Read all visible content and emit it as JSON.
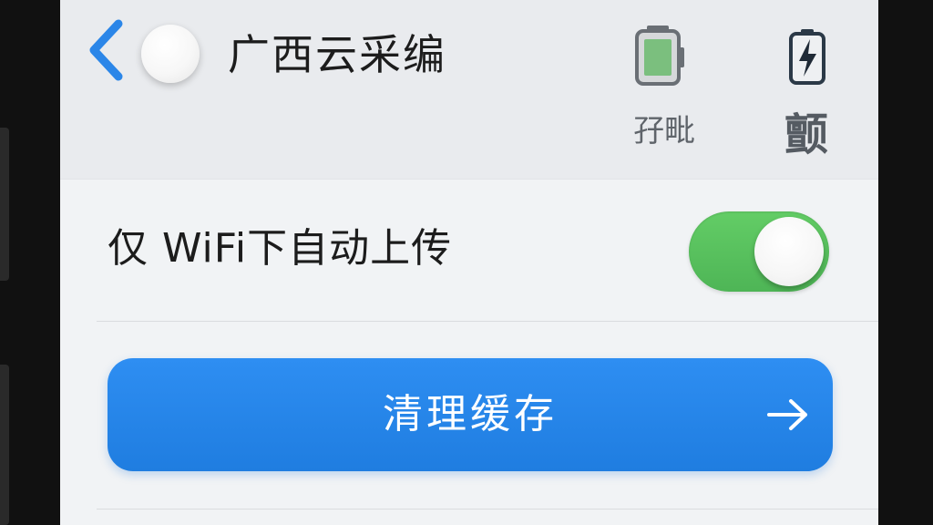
{
  "header": {
    "title": "广西云采编",
    "back_icon": "chevron-left-icon",
    "actions": [
      {
        "icon": "battery-status-icon",
        "label": "孖毗"
      },
      {
        "icon": "battery-charging-icon",
        "label": "颤"
      }
    ]
  },
  "settings": {
    "wifi_upload": {
      "label": "仅 WiFi下自动上传",
      "enabled": true
    }
  },
  "clear_cache": {
    "label": "清理缓存",
    "icon": "arrow-right-icon"
  },
  "colors": {
    "accent_blue": "#1f7de0",
    "toggle_green": "#4eb556",
    "back_chevron": "#2b86e8"
  }
}
